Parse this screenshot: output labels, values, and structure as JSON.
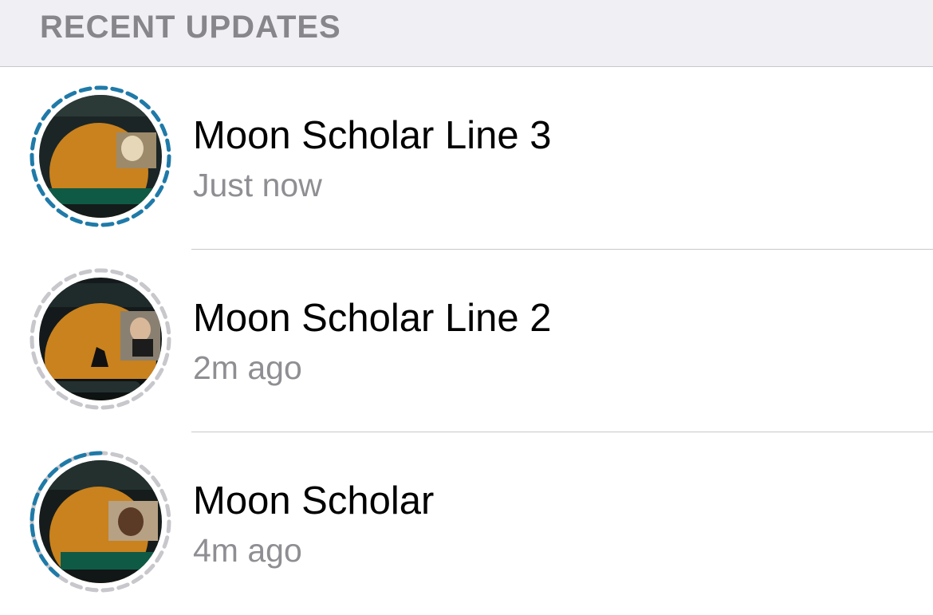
{
  "section_header": {
    "label": "RECENT UPDATES"
  },
  "colors": {
    "ring_unseen": "#1f7aa8",
    "ring_seen": "#c7c7cc",
    "header_bg": "#efeff4",
    "header_text": "#86868b",
    "name_text": "#000000",
    "time_text": "#8e8e93",
    "separator": "#c8c7cc"
  },
  "updates": [
    {
      "name": "Moon Scholar Line 3",
      "time": "Just now",
      "ring_state": "unseen",
      "thumbnail_icon": "status-thumbnail-icon"
    },
    {
      "name": "Moon Scholar Line 2",
      "time": "2m ago",
      "ring_state": "seen",
      "thumbnail_icon": "status-thumbnail-icon"
    },
    {
      "name": "Moon Scholar",
      "time": "4m ago",
      "ring_state": "partial",
      "thumbnail_icon": "status-thumbnail-icon"
    }
  ]
}
